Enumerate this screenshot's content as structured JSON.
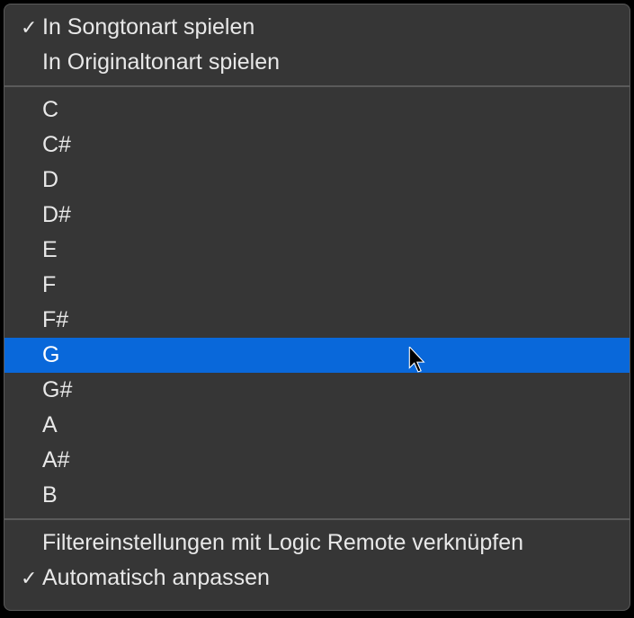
{
  "section1": {
    "items": [
      {
        "label": "In Songtonart spielen",
        "checked": true
      },
      {
        "label": "In Originaltonart spielen",
        "checked": false
      }
    ]
  },
  "section2": {
    "items": [
      {
        "label": "C",
        "checked": false,
        "highlighted": false
      },
      {
        "label": "C#",
        "checked": false,
        "highlighted": false
      },
      {
        "label": "D",
        "checked": false,
        "highlighted": false
      },
      {
        "label": "D#",
        "checked": false,
        "highlighted": false
      },
      {
        "label": "E",
        "checked": false,
        "highlighted": false
      },
      {
        "label": "F",
        "checked": false,
        "highlighted": false
      },
      {
        "label": "F#",
        "checked": false,
        "highlighted": false
      },
      {
        "label": "G",
        "checked": false,
        "highlighted": true
      },
      {
        "label": "G#",
        "checked": false,
        "highlighted": false
      },
      {
        "label": "A",
        "checked": false,
        "highlighted": false
      },
      {
        "label": "A#",
        "checked": false,
        "highlighted": false
      },
      {
        "label": "B",
        "checked": false,
        "highlighted": false
      }
    ]
  },
  "section3": {
    "items": [
      {
        "label": "Filtereinstellungen mit Logic Remote verknüpfen",
        "checked": false
      },
      {
        "label": "Automatisch anpassen",
        "checked": true
      }
    ]
  },
  "checkmark_glyph": "✓"
}
